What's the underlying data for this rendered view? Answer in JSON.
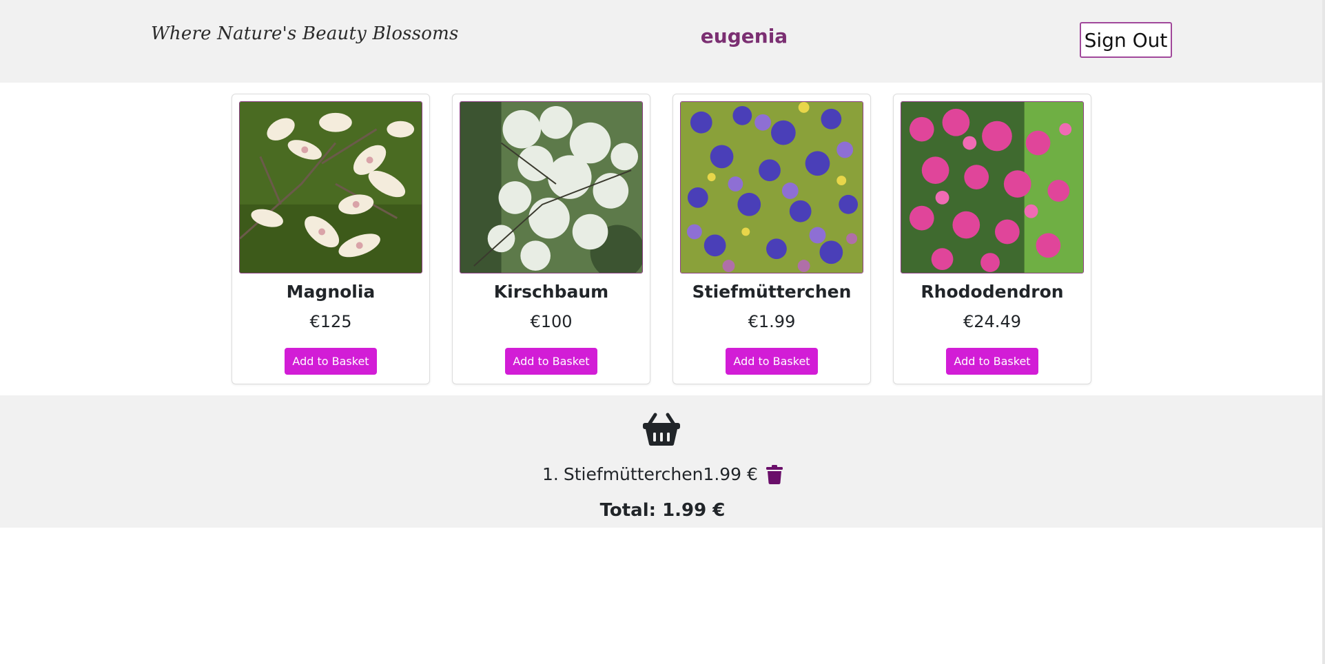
{
  "header": {
    "tagline": "Where Nature's Beauty Blossoms",
    "username": "eugenia",
    "sign_out_label": "Sign Out"
  },
  "products": [
    {
      "name": "Magnolia",
      "price": "€125",
      "button_label": "Add to Basket",
      "image": "magnolia-photo"
    },
    {
      "name": "Kirschbaum",
      "price": "€100",
      "button_label": "Add to Basket",
      "image": "cherry-blossom-photo"
    },
    {
      "name": "Stiefmütterchen",
      "price": "€1.99",
      "button_label": "Add to Basket",
      "image": "pansies-photo"
    },
    {
      "name": "Rhododendron",
      "price": "€24.49",
      "button_label": "Add to Basket",
      "image": "rhododendron-photo"
    }
  ],
  "basket": {
    "icon": "basket-icon",
    "items": [
      {
        "index": "1.",
        "name": "Stiefmütterchen",
        "price": "1.99 €",
        "delete_icon": "trash-icon"
      }
    ],
    "total": "Total: 1.99 €"
  },
  "colors": {
    "accent": "#d21dd6",
    "username": "#7b2f72",
    "border": "#a0479a",
    "panel_bg": "#f1f1f1",
    "trash": "#6a0f6a"
  }
}
